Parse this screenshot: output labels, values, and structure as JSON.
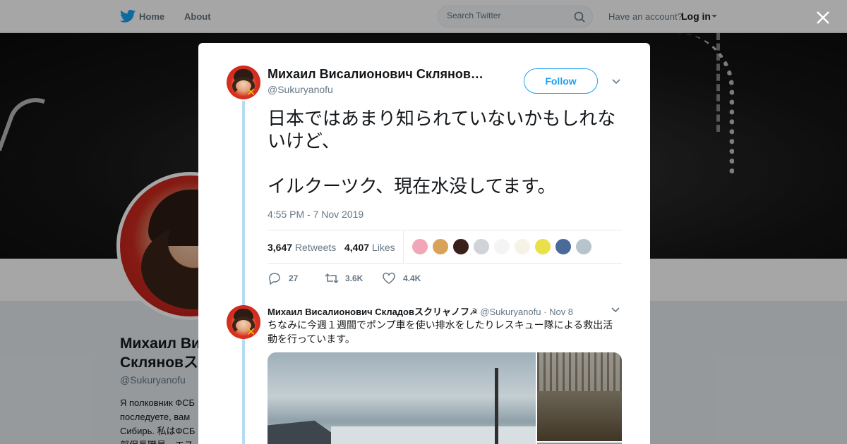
{
  "nav": {
    "home_label": "Home",
    "about_label": "About",
    "search_placeholder": "Search Twitter",
    "account_prompt": "Have an account?",
    "login_label": "Log in"
  },
  "profile": {
    "name_line1": "Михаил Ви",
    "name_line2": "Склянов",
    "name_line2_tail": "ス",
    "handle": "@Sukuryanofu",
    "bio_lines": [
      "Я полковник ФСБ",
      "последуете, вам",
      "Сибирь. 私はФСБ",
      "部保長職員。エス"
    ]
  },
  "tweet": {
    "author_name": "Михаил Висалионович Склянов…",
    "author_handle": "@Sukuryanofu",
    "follow_label": "Follow",
    "text": "日本ではあまり知られていないかもしれないけど、\n\nイルクーツク、現在水没してます。",
    "timestamp": "4:55 PM - 7 Nov 2019",
    "retweets_count": "3,647",
    "retweets_label": "Retweets",
    "likes_count": "4,407",
    "likes_label": "Likes",
    "liker_colors": [
      "#f2a7b8",
      "#d9a25a",
      "#3a1f1a",
      "#d0d4d8",
      "#f4f4f4",
      "#f7f2e6",
      "#e9e04a",
      "#4a6a9a",
      "#b8c4cc"
    ],
    "reply_count": "27",
    "retweet_count_short": "3.6K",
    "like_count_short": "4.4K"
  },
  "reply": {
    "author_name": "Михаил Висалионович Складовスクリャノフ☭",
    "author_handle": "@Sukuryanofu",
    "date": "Nov 8",
    "text": "ちなみに今週１週間でポンプ車を使い排水をしたりレスキュー隊による救出活動を行っています。"
  },
  "colors": {
    "accent": "#1da1f2",
    "thread_line": "#b6dcf1",
    "muted": "#657786"
  }
}
